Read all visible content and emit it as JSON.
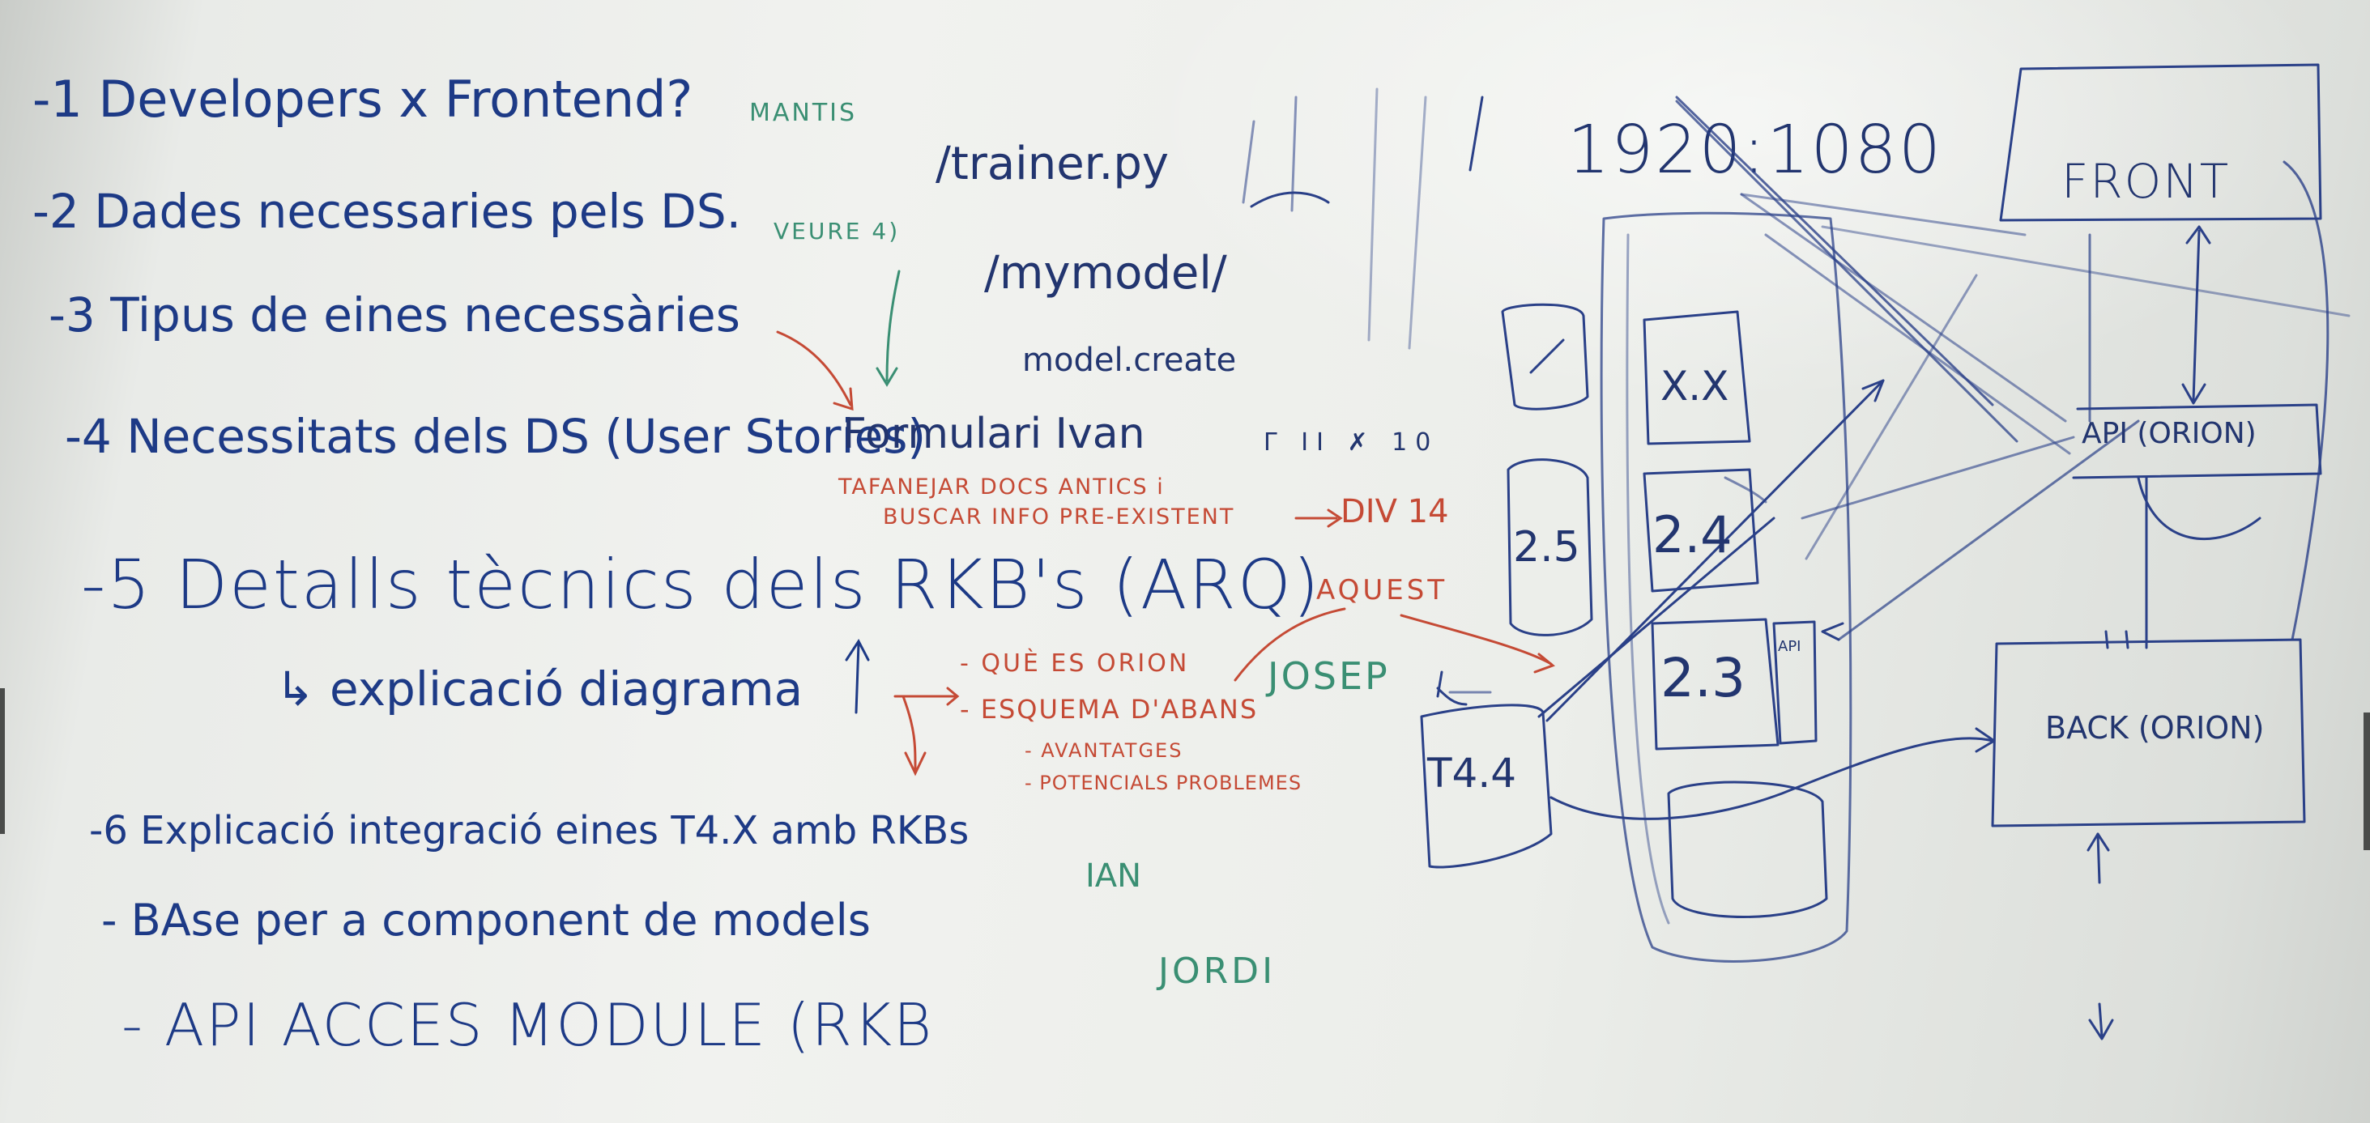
{
  "whiteboard": {
    "agenda": [
      {
        "text": "-1 Developers x Frontend?",
        "note": "MANTIS"
      },
      {
        "text": "-2 Dades necessaries pels DS.",
        "note": "VEURE 4)"
      },
      {
        "text": "-3 Tipus de eines necessàries"
      },
      {
        "text": "-4 Necessitats dels DS (User Stories)",
        "note": "Formulari Ivan"
      },
      {
        "text": "-5 Detalls tècnics dels RKB's (ARQ)"
      },
      {
        "text": "↳ explicació diagrama"
      },
      {
        "text": "-6 Explicació integració eines T4.X amb RKBs"
      },
      {
        "text": "- BAse per a component de models",
        "note": "IAN"
      },
      {
        "text": "- API ACCES MODULE (RKB",
        "note": "JORDI"
      }
    ],
    "red_notes": {
      "tafanejar_line1": "TAFANEJAR DOCS ANTICS i",
      "tafanejar_line2": "BUSCAR INFO PRE-EXISTENT",
      "tafanejar_target": "DIV 14",
      "aquest": "AQUEST",
      "que_es_orion": "- QUÈ ES ORION",
      "esquema": "- ESQUEMA D'ABANS",
      "avantatges": "- AVANTATGES",
      "potencials": "- POTENCIALS PROBLEMES"
    },
    "names": {
      "josep": "JOSEP"
    },
    "top_notes": {
      "trainer": "/trainer.py",
      "mymodel": "/mymodel/",
      "model_create": "model.create",
      "marks": "Γ II ✗ 10",
      "resolution": "1920:1080"
    },
    "diagram": {
      "front": "FRONT",
      "api": "API (ORION)",
      "back": "BACK (ORION)",
      "boxes": [
        "X.X",
        "2.5",
        "2.4",
        "2.3",
        "T4.4"
      ],
      "api_small": "API"
    }
  }
}
